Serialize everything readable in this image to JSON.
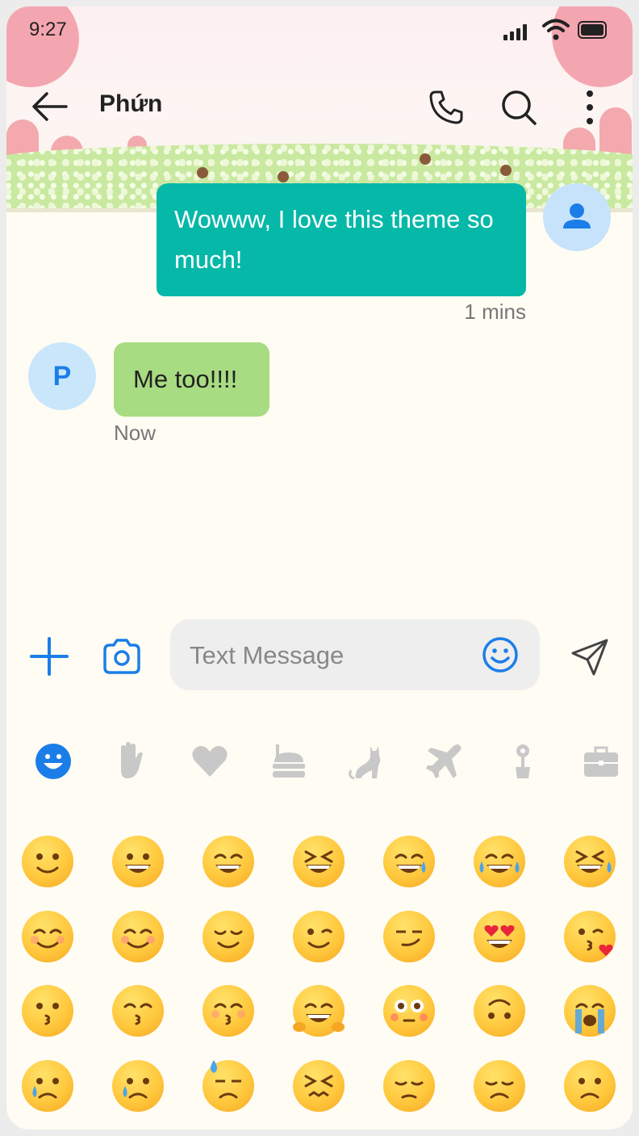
{
  "status_bar": {
    "time": "9:27"
  },
  "header": {
    "title": "Phứn",
    "icons": [
      "back-arrow-icon",
      "phone-icon",
      "search-icon",
      "more-vertical-icon"
    ]
  },
  "messages": [
    {
      "direction": "outgoing",
      "text": "Wowww, I love this theme so much!",
      "time": "1 mins"
    },
    {
      "direction": "incoming",
      "sender_initial": "P",
      "text": "Me too!!!!",
      "time": "Now"
    }
  ],
  "compose": {
    "placeholder": "Text Message",
    "value": ""
  },
  "emoji_categories": [
    "smileys",
    "gestures",
    "hearts",
    "food",
    "animals",
    "travel",
    "nature",
    "objects"
  ],
  "emoji_rows": [
    [
      "slightly-smiling",
      "grinning",
      "beaming",
      "squinting-laugh",
      "sweat-smile",
      "tears-of-joy",
      "rolling-laughing"
    ],
    [
      "smiling-eyes",
      "relieved-blush",
      "relieved",
      "winking",
      "smirking",
      "heart-eyes",
      "kissing-heart"
    ],
    [
      "kissing",
      "kissing-smiling-eyes",
      "kissing-closed-eyes",
      "hugging",
      "flushed",
      "upside-down",
      "loudly-crying"
    ],
    [
      "crying",
      "crying-2",
      "downcast-sweat",
      "confounded",
      "pensive",
      "disappointed",
      "frowning"
    ]
  ],
  "colors": {
    "outgoing_bubble": "#05b8a8",
    "incoming_bubble": "#a8dc82",
    "accent": "#1b7ee8",
    "background": "#fffcf3"
  }
}
